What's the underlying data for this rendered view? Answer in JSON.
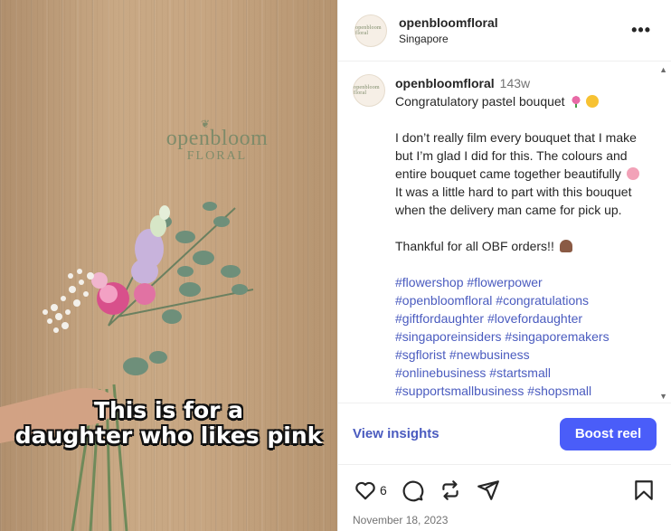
{
  "media": {
    "brand_logo_line1": "openbloom",
    "brand_logo_line2": "FLORAL",
    "caption_line1": "This is for a",
    "caption_line2": "daughter who likes pink"
  },
  "header": {
    "username": "openbloomfloral",
    "location": "Singapore",
    "more_label": "•••",
    "avatar_text": "openbloom floral"
  },
  "caption": {
    "username": "openbloomfloral",
    "time": "143w",
    "title": "Congratulatory pastel bouquet",
    "paragraph1": "I don’t really film every bouquet that I make but I’m glad I did for this. The colours and entire bouquet came together beautifully",
    "paragraph1_end": "It was a little hard to part with this bouquet when the delivery man came for pick up.",
    "paragraph2": "Thankful for all OBF orders!!",
    "hashtags": [
      "#flowershop",
      "#flowerpower",
      "#openbloomfloral",
      "#congratulations",
      "#giftfordaughter",
      "#lovefordaughter",
      "#singaporeinsiders",
      "#singaporemakers",
      "#sgflorist",
      "#newbusiness",
      "#onlinebusiness",
      "#startsmall",
      "#supportsmallbusiness",
      "#shopsmall"
    ]
  },
  "actions": {
    "insights_label": "View insights",
    "boost_label": "Boost reel"
  },
  "footer": {
    "like_count": "6",
    "date": "November 18, 2023"
  },
  "icons": [
    "heart-icon",
    "comment-icon",
    "repost-icon",
    "share-icon",
    "bookmark-icon",
    "more-icon",
    "tulip-emoji",
    "face-emoji",
    "heart-face-emoji",
    "brown-heart-emoji"
  ],
  "colors": {
    "link": "#4a5bbf",
    "boost_button": "#4a5df9",
    "muted": "#737373"
  }
}
